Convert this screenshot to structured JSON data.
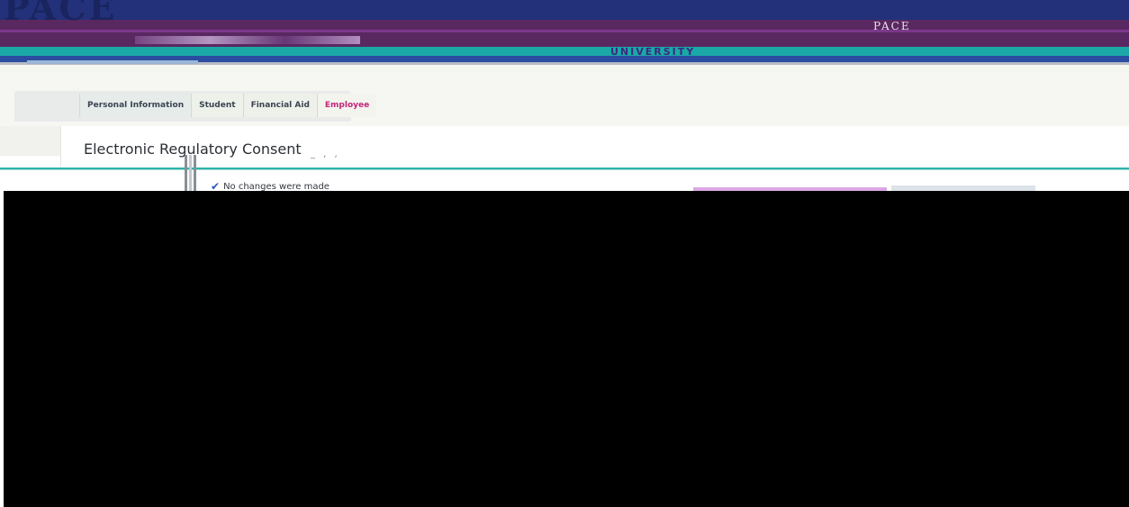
{
  "header": {
    "logo_text": "PACE",
    "logo_small": "PACE",
    "logo_subtext": "UNIVERSITY",
    "colors": {
      "navy": "#23317a",
      "purple": "#5a2860",
      "teal": "#1aa9a7"
    }
  },
  "tabs": [
    {
      "label": "Personal Information",
      "active": false
    },
    {
      "label": "Student",
      "active": false
    },
    {
      "label": "Financial Aid",
      "active": false
    },
    {
      "label": "Employee",
      "active": true,
      "color": "#c2257a"
    }
  ],
  "page": {
    "title": "Electronic Regulatory Consent"
  },
  "message": {
    "icon": "check-icon",
    "text": "No changes were made"
  }
}
